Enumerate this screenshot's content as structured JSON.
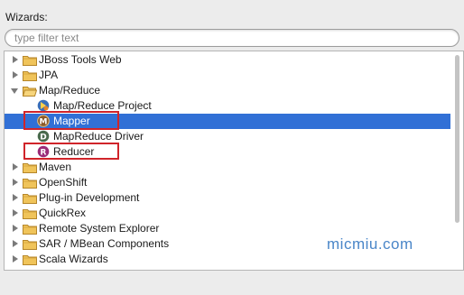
{
  "header": {
    "label": "Wizards:"
  },
  "filter": {
    "placeholder": "type filter text",
    "value": ""
  },
  "tree": {
    "items": [
      {
        "label": "JBoss Tools Web",
        "kind": "folder",
        "expanded": false
      },
      {
        "label": "JPA",
        "kind": "folder",
        "expanded": false
      },
      {
        "label": "Map/Reduce",
        "kind": "folder",
        "expanded": true
      },
      {
        "label": "Map/Reduce Project",
        "kind": "item",
        "icon": "map-reduce-project-icon"
      },
      {
        "label": "Mapper",
        "kind": "item",
        "icon": "mapper-icon",
        "selected": true
      },
      {
        "label": "MapReduce Driver",
        "kind": "item",
        "icon": "mapreduce-driver-icon"
      },
      {
        "label": "Reducer",
        "kind": "item",
        "icon": "reducer-icon"
      },
      {
        "label": "Maven",
        "kind": "folder",
        "expanded": false
      },
      {
        "label": "OpenShift",
        "kind": "folder",
        "expanded": false
      },
      {
        "label": "Plug-in Development",
        "kind": "folder",
        "expanded": false
      },
      {
        "label": "QuickRex",
        "kind": "folder",
        "expanded": false
      },
      {
        "label": "Remote System Explorer",
        "kind": "folder",
        "expanded": false
      },
      {
        "label": "SAR / MBean Components",
        "kind": "folder",
        "expanded": false
      },
      {
        "label": "Scala Wizards",
        "kind": "folder",
        "expanded": false
      }
    ]
  },
  "watermark": "micmiu.com",
  "colors": {
    "selection": "#3170d6",
    "highlight": "#d0242a",
    "folder": "#e9b84d"
  }
}
